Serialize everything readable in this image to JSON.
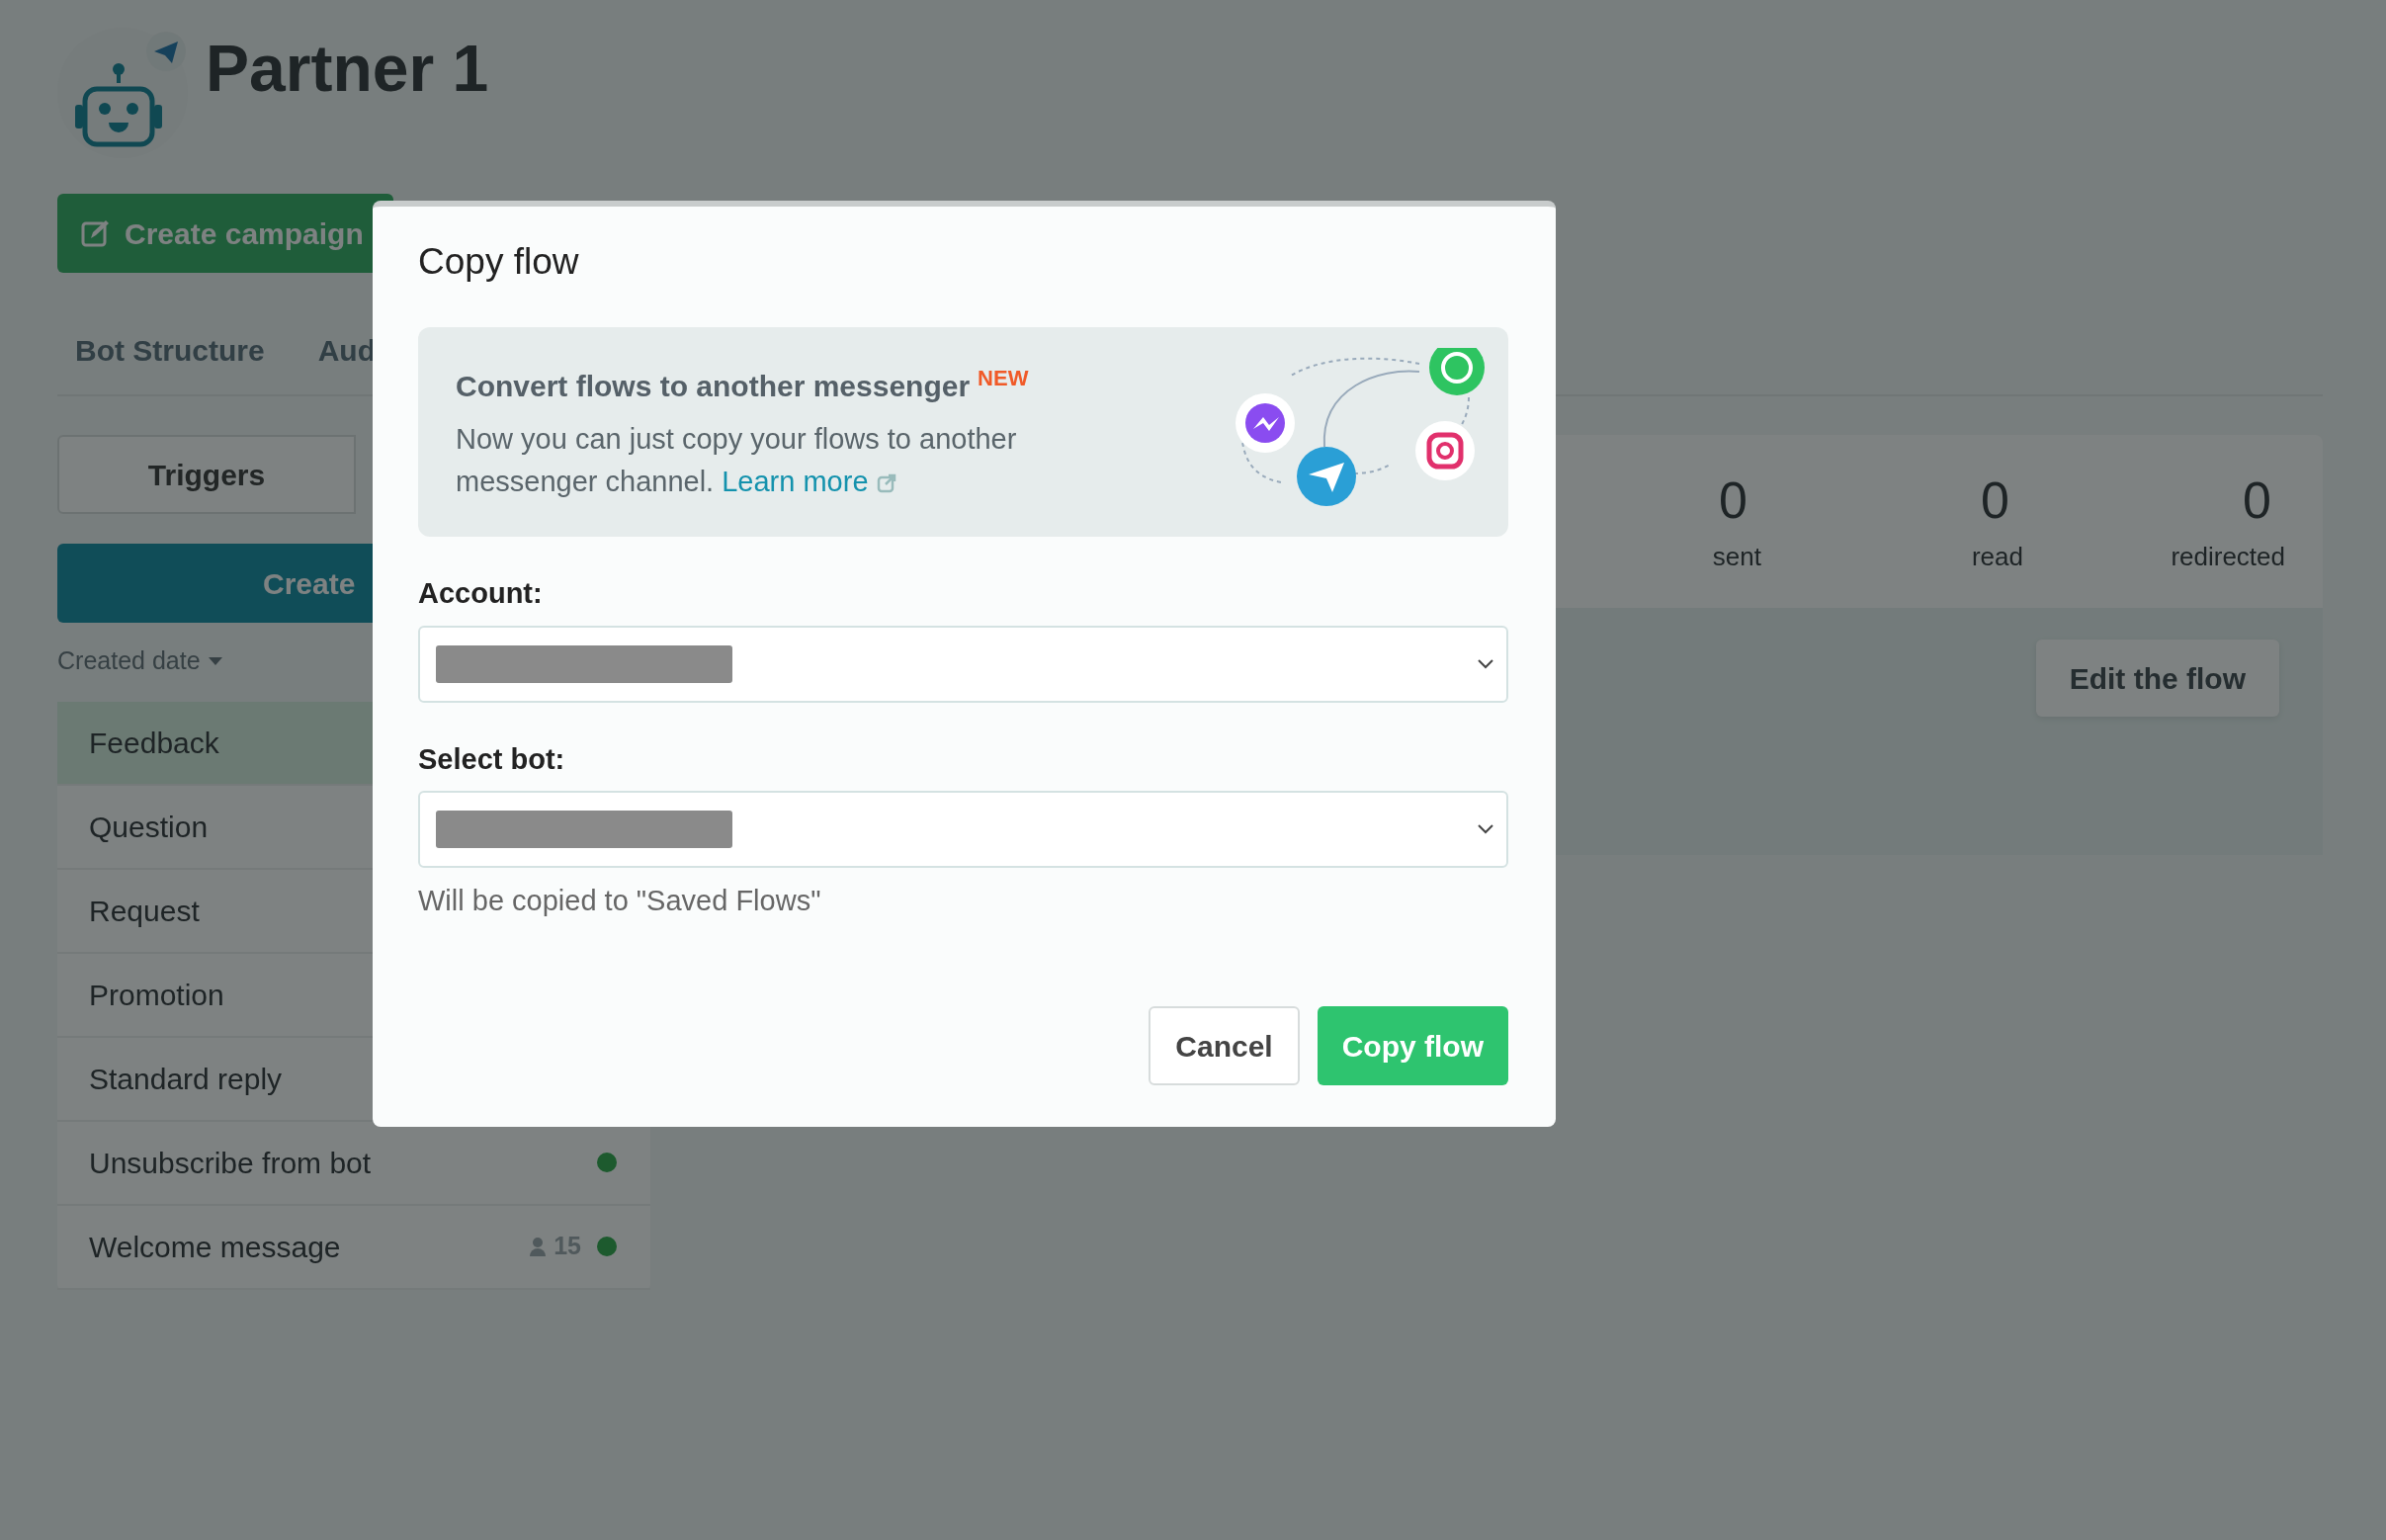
{
  "header": {
    "title": "Partner 1"
  },
  "create_campaign": "Create campaign",
  "tabs": [
    {
      "label": "Bot Structure"
    },
    {
      "label": "Aud"
    }
  ],
  "segment": "Triggers",
  "create_button": "Create",
  "sort": "Created date",
  "flows": [
    {
      "name": "Feedback",
      "selected": true
    },
    {
      "name": "Question",
      "selected": false
    },
    {
      "name": "Request",
      "selected": false
    },
    {
      "name": "Promotion",
      "selected": false
    },
    {
      "name": "Standard reply",
      "selected": false
    },
    {
      "name": "Unsubscribe from bot",
      "selected": false,
      "active": true
    },
    {
      "name": "Welcome message",
      "selected": false,
      "active": true,
      "users": "15"
    }
  ],
  "stats": [
    {
      "value": "0",
      "label": "sent"
    },
    {
      "value": "0",
      "label": "read"
    },
    {
      "value": "0",
      "label": "redirected"
    }
  ],
  "edit_button": "Edit the flow",
  "modal": {
    "title": "Copy flow",
    "banner": {
      "title": "Convert flows to another messenger",
      "badge": "NEW",
      "text": "Now you can just copy your flows to another messenger channel.",
      "link": "Learn more"
    },
    "fields": [
      {
        "label": "Account:"
      },
      {
        "label": "Select bot:",
        "hint": "Will be copied to \"Saved Flows\""
      }
    ],
    "buttons": [
      {
        "label": "Cancel",
        "kind": "secondary"
      },
      {
        "label": "Copy flow",
        "kind": "primary"
      }
    ]
  }
}
